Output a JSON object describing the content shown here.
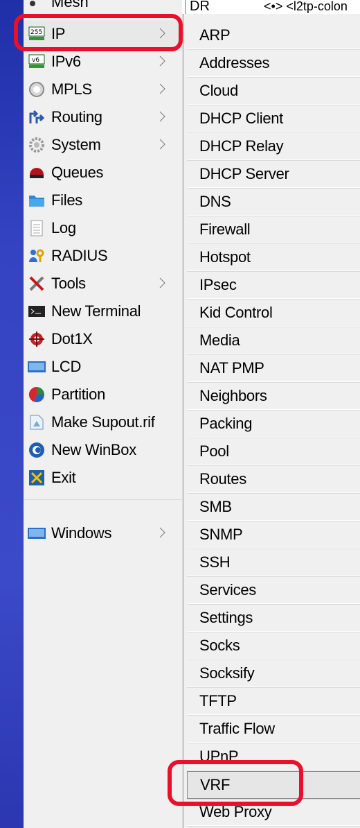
{
  "main_menu": {
    "partial_item": {
      "label": "Mesh"
    },
    "items": [
      {
        "label": "IP",
        "icon": "ip-icon",
        "has_submenu": true
      },
      {
        "label": "IPv6",
        "icon": "ipv6-icon",
        "has_submenu": true
      },
      {
        "label": "MPLS",
        "icon": "mpls-icon",
        "has_submenu": true
      },
      {
        "label": "Routing",
        "icon": "routing-icon",
        "has_submenu": true
      },
      {
        "label": "System",
        "icon": "system-gear-icon",
        "has_submenu": true
      },
      {
        "label": "Queues",
        "icon": "queues-icon",
        "has_submenu": false
      },
      {
        "label": "Files",
        "icon": "folder-icon",
        "has_submenu": false
      },
      {
        "label": "Log",
        "icon": "log-icon",
        "has_submenu": false
      },
      {
        "label": "RADIUS",
        "icon": "radius-icon",
        "has_submenu": false
      },
      {
        "label": "Tools",
        "icon": "tools-icon",
        "has_submenu": true
      },
      {
        "label": "New Terminal",
        "icon": "terminal-icon",
        "has_submenu": false
      },
      {
        "label": "Dot1X",
        "icon": "dot1x-icon",
        "has_submenu": false
      },
      {
        "label": "LCD",
        "icon": "lcd-icon",
        "has_submenu": false
      },
      {
        "label": "Partition",
        "icon": "partition-pie-icon",
        "has_submenu": false
      },
      {
        "label": "Make Supout.rif",
        "icon": "supout-icon",
        "has_submenu": false
      },
      {
        "label": "New WinBox",
        "icon": "winbox-icon",
        "has_submenu": false
      },
      {
        "label": "Exit",
        "icon": "exit-icon",
        "has_submenu": false
      }
    ],
    "windows": {
      "label": "Windows",
      "icon": "windows-icon",
      "has_submenu": true
    }
  },
  "topbar": {
    "col1": "DR",
    "col2": "<•> <l2tp-colon"
  },
  "ip_submenu": {
    "items": [
      "ARP",
      "Addresses",
      "Cloud",
      "DHCP Client",
      "DHCP Relay",
      "DHCP Server",
      "DNS",
      "Firewall",
      "Hotspot",
      "IPsec",
      "Kid Control",
      "Media",
      "NAT PMP",
      "Neighbors",
      "Packing",
      "Pool",
      "Routes",
      "SMB",
      "SNMP",
      "SSH",
      "Services",
      "Settings",
      "Socks",
      "Socksify",
      "TFTP",
      "Traffic Flow",
      "UPnP",
      "VRF",
      "Web Proxy"
    ],
    "highlighted": "VRF"
  },
  "colors": {
    "annotation": "#e8102a",
    "menu_bg": "#f0f0f0",
    "side_strip": "#3443c2"
  }
}
